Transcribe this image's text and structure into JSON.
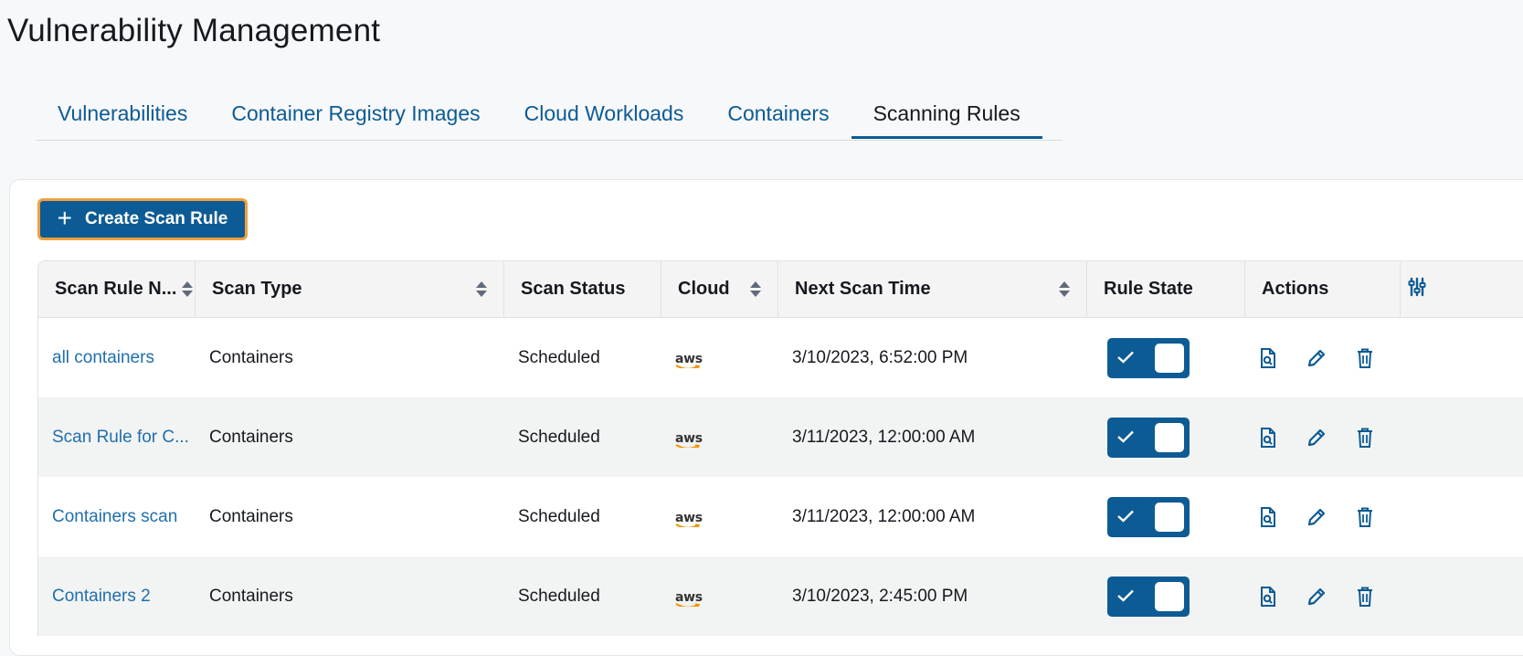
{
  "page": {
    "title": "Vulnerability Management"
  },
  "tabs": [
    {
      "label": "Vulnerabilities",
      "active": false
    },
    {
      "label": "Container Registry Images",
      "active": false
    },
    {
      "label": "Cloud Workloads",
      "active": false
    },
    {
      "label": "Containers",
      "active": false
    },
    {
      "label": "Scanning Rules",
      "active": true
    }
  ],
  "toolbar": {
    "create_label": "Create Scan Rule",
    "create_icon": "plus-icon"
  },
  "table": {
    "columns": [
      {
        "label": "Scan Rule N...",
        "sortable": true
      },
      {
        "label": "Scan Type",
        "sortable": true
      },
      {
        "label": "Scan Status",
        "sortable": false
      },
      {
        "label": "Cloud",
        "sortable": true
      },
      {
        "label": "Next Scan Time",
        "sortable": true
      },
      {
        "label": "Rule State",
        "sortable": false
      },
      {
        "label": "Actions",
        "sortable": false
      }
    ],
    "column_settings_icon": "sliders-icon",
    "rows": [
      {
        "name": "all containers",
        "type": "Containers",
        "status": "Scheduled",
        "cloud": "aws",
        "next_scan": "3/10/2023, 6:52:00 PM",
        "enabled": true
      },
      {
        "name": "Scan Rule for C...",
        "type": "Containers",
        "status": "Scheduled",
        "cloud": "aws",
        "next_scan": "3/11/2023, 12:00:00 AM",
        "enabled": true
      },
      {
        "name": "Containers scan",
        "type": "Containers",
        "status": "Scheduled",
        "cloud": "aws",
        "next_scan": "3/11/2023, 12:00:00 AM",
        "enabled": true
      },
      {
        "name": "Containers 2",
        "type": "Containers",
        "status": "Scheduled",
        "cloud": "aws",
        "next_scan": "3/10/2023, 2:45:00 PM",
        "enabled": true
      }
    ],
    "row_actions": [
      "view-report-icon",
      "edit-icon",
      "delete-icon"
    ]
  },
  "colors": {
    "primary": "#0d5b94",
    "link": "#1f6fad",
    "focus": "#f0a03c",
    "aws_smile": "#f29100"
  }
}
